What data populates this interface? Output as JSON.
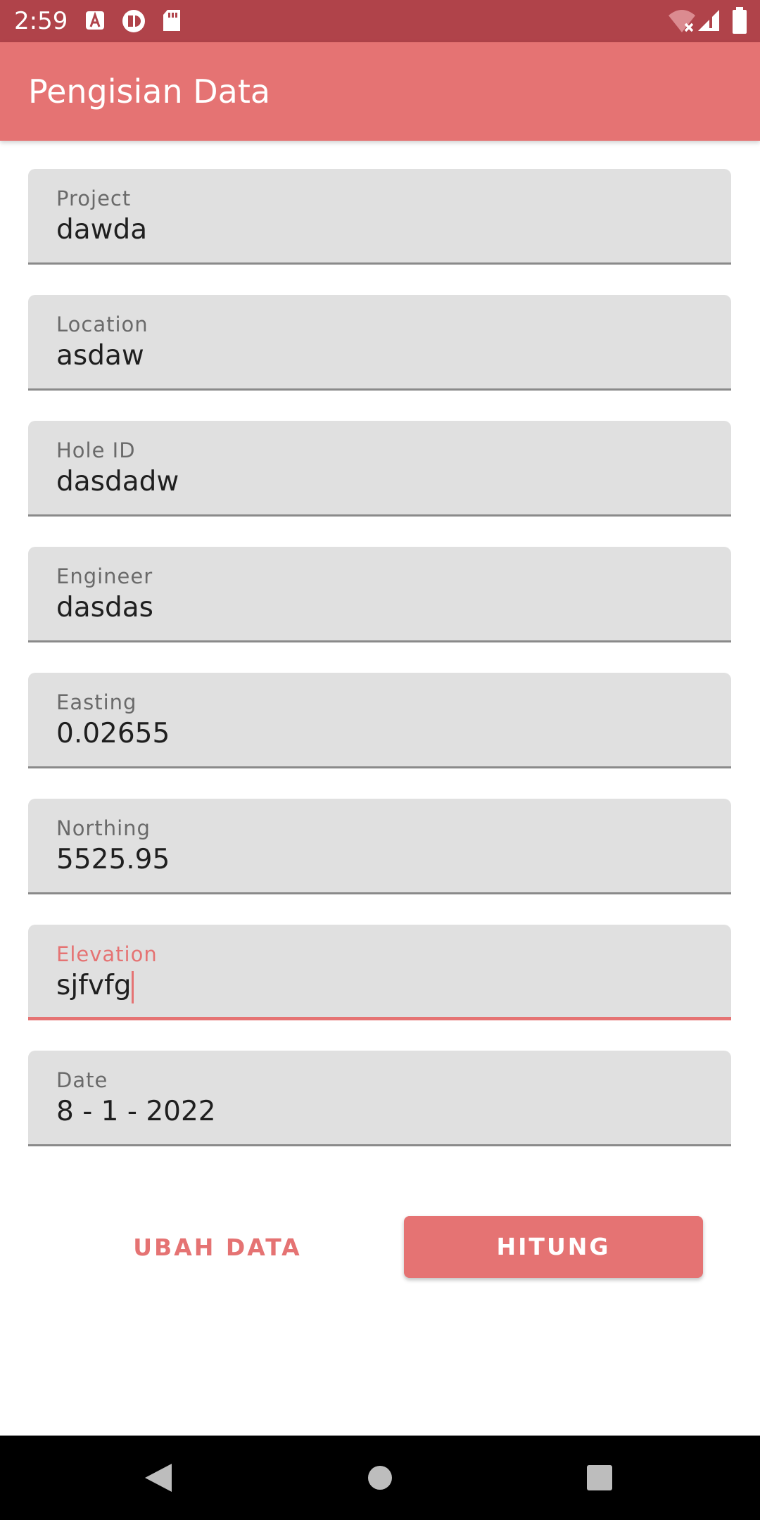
{
  "status_bar": {
    "time": "2:59",
    "icons": [
      "accessibility-a-icon",
      "vpn-icon",
      "sd-card-icon",
      "wifi-off-icon",
      "cell-signal-icon",
      "battery-icon"
    ]
  },
  "app_bar": {
    "title": "Pengisian Data"
  },
  "form": {
    "fields": [
      {
        "label": "Project",
        "value": "dawda"
      },
      {
        "label": "Location",
        "value": "asdaw"
      },
      {
        "label": "Hole ID",
        "value": "dasdadw"
      },
      {
        "label": "Engineer",
        "value": "dasdas"
      },
      {
        "label": "Easting",
        "value": "0.02655"
      },
      {
        "label": "Northing",
        "value": "5525.95"
      },
      {
        "label": "Elevation",
        "value": "sjfvfg"
      },
      {
        "label": "Date",
        "value": "8 - 1 - 2022"
      }
    ],
    "focused_field": "Elevation"
  },
  "actions": {
    "secondary_label": "UBAH DATA",
    "primary_label": "HITUNG"
  },
  "nav_bar": {
    "buttons": [
      "back-icon",
      "home-icon",
      "recents-icon"
    ]
  },
  "colors": {
    "status_bar": "#b0434a",
    "accent": "#e57373",
    "field_bg": "#e0e0e0",
    "nav_bar": "#000000"
  }
}
